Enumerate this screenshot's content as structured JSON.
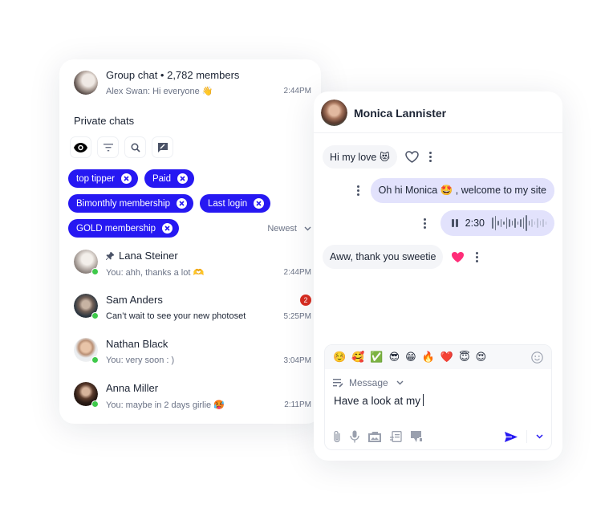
{
  "left_panel": {
    "group": {
      "title": "Group chat • 2,782 members",
      "preview": "Alex Swan: Hi everyone 👋",
      "time": "2:44PM"
    },
    "section_label": "Private chats",
    "toolbar": [
      {
        "icon": "eye-icon"
      },
      {
        "icon": "filter-icon"
      },
      {
        "icon": "search-icon"
      },
      {
        "icon": "compose-icon"
      }
    ],
    "filter_chips": [
      {
        "label": "top tipper"
      },
      {
        "label": "Paid"
      },
      {
        "label": "Bimonthly membership"
      },
      {
        "label": "Last login"
      },
      {
        "label": "GOLD membership"
      }
    ],
    "sort": {
      "label": "Newest"
    },
    "chats": [
      {
        "name": "Lana Steiner",
        "pinned": true,
        "preview": "You: ahh, thanks a lot 🫶",
        "time": "2:44PM",
        "online": true,
        "unread": null
      },
      {
        "name": "Sam Anders",
        "pinned": false,
        "preview": "Can’t wait to see your new photoset",
        "time": "5:25PM",
        "online": true,
        "unread": "2"
      },
      {
        "name": "Nathan Black",
        "pinned": false,
        "preview": "You: very soon : )",
        "time": "3:04PM",
        "online": true,
        "unread": null
      },
      {
        "name": "Anna Miller",
        "pinned": false,
        "preview": "You: maybe in 2 days girlie 🥵",
        "time": "2:11PM",
        "online": true,
        "unread": null
      }
    ]
  },
  "conversation": {
    "contact_name": "Monica Lannister",
    "messages": [
      {
        "direction": "incoming",
        "text": "Hi my love 😻",
        "reaction": "heart-outline"
      },
      {
        "direction": "outgoing",
        "text": "Oh hi Monica 🤩 , welcome to my site"
      },
      {
        "direction": "outgoing",
        "type": "voice",
        "duration": "2:30",
        "state": "playing"
      },
      {
        "direction": "incoming",
        "text": "Aww, thank you sweetie",
        "reaction": "heart-filled"
      }
    ],
    "composer": {
      "quick_emojis": [
        "☺️",
        "🥰",
        "✅",
        "😎",
        "😁",
        "🔥",
        "❤️",
        "😇",
        "😍"
      ],
      "mode_label": "Message",
      "draft": "Have a look at my"
    }
  },
  "colors": {
    "accent": "#2618f2",
    "outgoing_bubble": "#e2e2fc",
    "incoming_bubble": "#f4f5f8",
    "online": "#3ec94a",
    "badge": "#d92d20",
    "reaction_heart": "#ff2d78"
  }
}
